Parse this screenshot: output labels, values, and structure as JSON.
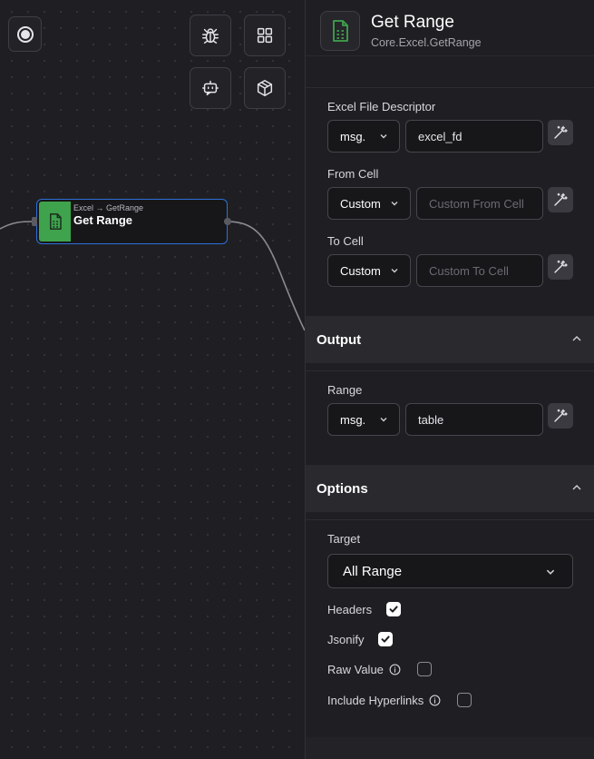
{
  "node": {
    "breadcrumb": "Excel → GetRange",
    "title": "Get Range",
    "accent_color": "#3fa34d",
    "border_color": "#2e6fd8"
  },
  "toolbar": {
    "icons": [
      "record-icon",
      "bug-icon",
      "grid-icon",
      "bot-icon",
      "package-icon"
    ]
  },
  "panel": {
    "title": "Get Range",
    "subtitle": "Core.Excel.GetRange",
    "inputs": {
      "excel_fd": {
        "label": "Excel File Descriptor",
        "type": "msg.",
        "value": "excel_fd"
      },
      "from_cell": {
        "label": "From Cell",
        "type": "Custom",
        "placeholder": "Custom From Cell"
      },
      "to_cell": {
        "label": "To Cell",
        "type": "Custom",
        "placeholder": "Custom To Cell"
      }
    },
    "output": {
      "section_title": "Output",
      "range": {
        "label": "Range",
        "type": "msg.",
        "value": "table"
      }
    },
    "options": {
      "section_title": "Options",
      "target": {
        "label": "Target",
        "value": "All Range"
      },
      "headers": {
        "label": "Headers",
        "checked": true
      },
      "jsonify": {
        "label": "Jsonify",
        "checked": true
      },
      "raw_value": {
        "label": "Raw Value",
        "checked": false
      },
      "include_hyperlinks": {
        "label": "Include Hyperlinks",
        "checked": false
      }
    }
  }
}
